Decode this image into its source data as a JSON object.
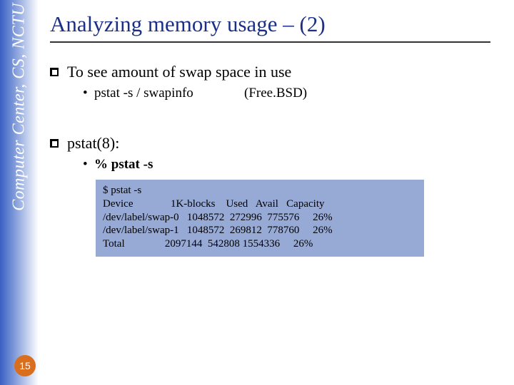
{
  "sidebar": {
    "label": "Computer Center, CS, NCTU"
  },
  "slide_number": "15",
  "title": "Analyzing memory usage – (2)",
  "items": [
    {
      "text": "To see amount of swap space in use",
      "sub": [
        {
          "left": "pstat -s / swapinfo",
          "right": "(Free.BSD)"
        }
      ]
    },
    {
      "text": "pstat(8):",
      "sub": [
        {
          "left": "% pstat -s",
          "right": ""
        }
      ]
    }
  ],
  "code": {
    "prompt": "$ pstat -s",
    "header": "Device              1K-blocks    Used   Avail   Capacity",
    "rows": [
      "/dev/label/swap-0   1048572  272996  775576     26%",
      "/dev/label/swap-1   1048572  269812  778760     26%",
      "Total               2097144  542808 1554336     26%"
    ]
  }
}
